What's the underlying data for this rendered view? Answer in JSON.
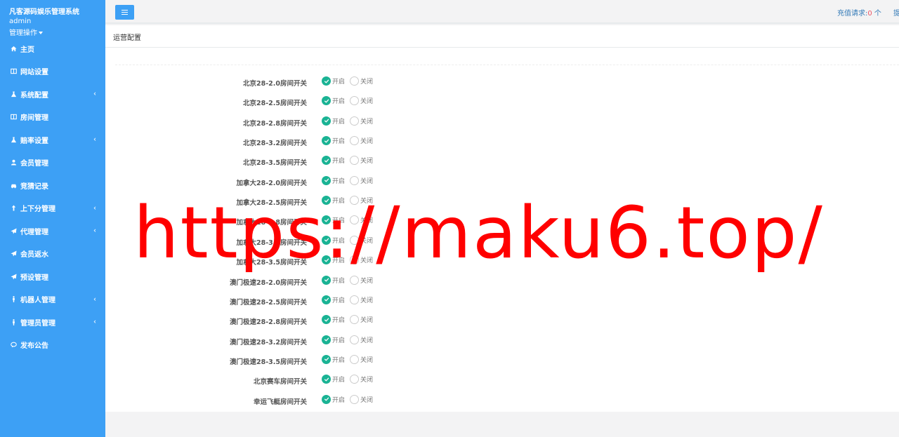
{
  "sidebar": {
    "brand": "凡客源码娱乐管理系统",
    "user": "admin",
    "ops_label": "管理操作",
    "items": [
      {
        "label": "主页",
        "icon": "home-icon",
        "sub": false
      },
      {
        "label": "网站设置",
        "icon": "columns-icon",
        "sub": false
      },
      {
        "label": "系统配置",
        "icon": "flask-icon",
        "sub": true
      },
      {
        "label": "房间管理",
        "icon": "columns-icon",
        "sub": false
      },
      {
        "label": "赔率设置",
        "icon": "flask-icon",
        "sub": true
      },
      {
        "label": "会员管理",
        "icon": "user-icon",
        "sub": false
      },
      {
        "label": "竞猜记录",
        "icon": "car-icon",
        "sub": false
      },
      {
        "label": "上下分管理",
        "icon": "arrow-icon",
        "sub": true
      },
      {
        "label": "代理管理",
        "icon": "send-icon",
        "sub": true
      },
      {
        "label": "会员返水",
        "icon": "send-icon",
        "sub": false
      },
      {
        "label": "预设管理",
        "icon": "send-icon",
        "sub": false
      },
      {
        "label": "机器人管理",
        "icon": "male-icon",
        "sub": true
      },
      {
        "label": "管理员管理",
        "icon": "male-icon",
        "sub": true
      },
      {
        "label": "发布公告",
        "icon": "comment-icon",
        "sub": false
      }
    ]
  },
  "topbar": {
    "recharge_label": "充值请求:",
    "recharge_count": "0",
    "recharge_unit": " 个",
    "extra_label": "提"
  },
  "panel": {
    "title": "运营配置",
    "on_label": "开启",
    "off_label": "关闭",
    "rows": [
      {
        "label": "北京28-2.0房间开关",
        "state": "on"
      },
      {
        "label": "北京28-2.5房间开关",
        "state": "on"
      },
      {
        "label": "北京28-2.8房间开关",
        "state": "on"
      },
      {
        "label": "北京28-3.2房间开关",
        "state": "on"
      },
      {
        "label": "北京28-3.5房间开关",
        "state": "on"
      },
      {
        "label": "加拿大28-2.0房间开关",
        "state": "on"
      },
      {
        "label": "加拿大28-2.5房间开关",
        "state": "on"
      },
      {
        "label": "加拿大28-2.8房间开关",
        "state": "on"
      },
      {
        "label": "加拿大28-3.2房间开关",
        "state": "on"
      },
      {
        "label": "加拿大28-3.5房间开关",
        "state": "on"
      },
      {
        "label": "澳门极速28-2.0房间开关",
        "state": "on"
      },
      {
        "label": "澳门极速28-2.5房间开关",
        "state": "on"
      },
      {
        "label": "澳门极速28-2.8房间开关",
        "state": "on"
      },
      {
        "label": "澳门极速28-3.2房间开关",
        "state": "on"
      },
      {
        "label": "澳门极速28-3.5房间开关",
        "state": "on"
      },
      {
        "label": "北京赛车房间开关",
        "state": "on"
      },
      {
        "label": "幸运飞艇房间开关",
        "state": "on"
      }
    ]
  },
  "watermark": "https://maku6.top/",
  "colors": {
    "sidebar_bg": "#3da0f5",
    "accent_on": "#1ab394",
    "link": "#337ab7",
    "count": "#ed5565",
    "watermark": "#ff0000"
  }
}
